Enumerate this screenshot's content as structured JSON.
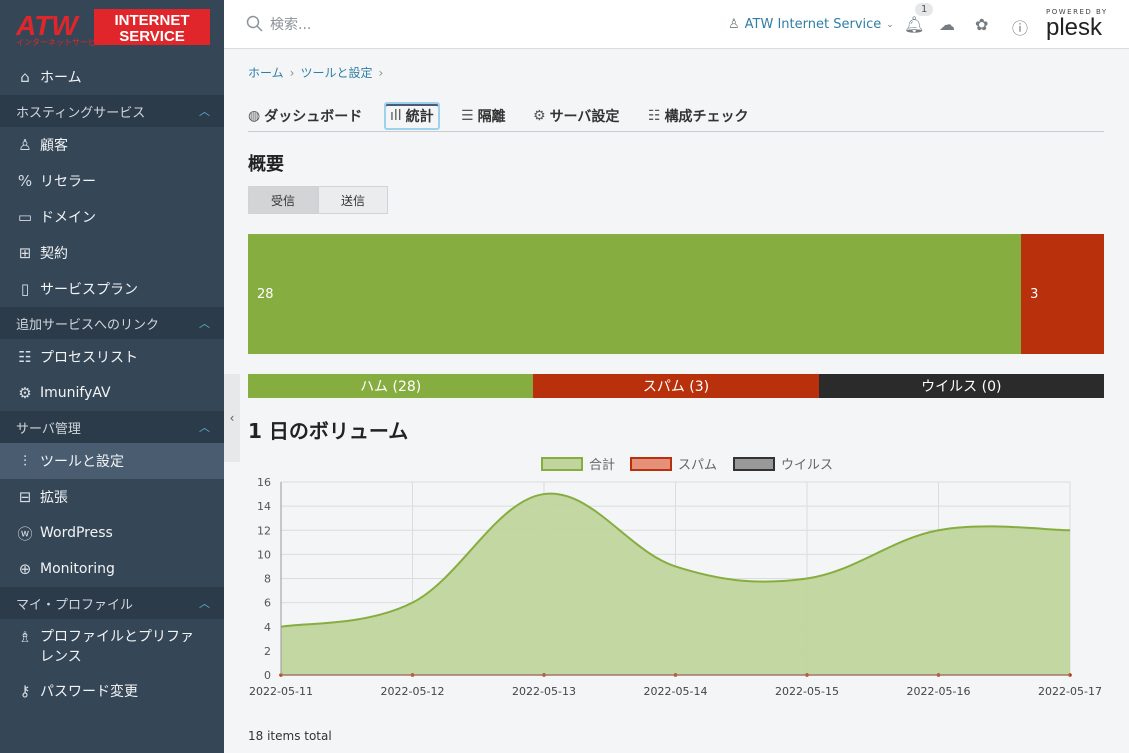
{
  "brand": {
    "line1": "ATW",
    "line2": "INTERNET",
    "line3": "SERVICE",
    "sub": "インターネットサービス"
  },
  "sidebar": {
    "home": "ホーム",
    "sec_hosting": "ホスティングサービス",
    "customers": "顧客",
    "resellers": "リセラー",
    "domains": "ドメイン",
    "subscriptions": "契約",
    "service_plans": "サービスプラン",
    "sec_links": "追加サービスへのリンク",
    "process_list": "プロセスリスト",
    "imunify": "ImunifyAV",
    "sec_server": "サーバ管理",
    "tools": "ツールと設定",
    "extensions": "拡張",
    "wordpress": "WordPress",
    "monitoring": "Monitoring",
    "sec_profile": "マイ・プロファイル",
    "profile_prefs": "プロファイルとプリファレンス",
    "password": "パスワード変更"
  },
  "topbar": {
    "search_placeholder": "検索...",
    "account": "ATW Internet Service",
    "notif_count": "1",
    "plesk_powered": "POWERED BY",
    "plesk_name": "plesk"
  },
  "breadcrumb": {
    "home": "ホーム",
    "tools": "ツールと設定"
  },
  "tabs": [
    "ダッシュボード",
    "統計",
    "隔離",
    "サーバ設定",
    "構成チェック"
  ],
  "overview": {
    "title": "概要",
    "incoming": "受信",
    "outgoing": "送信",
    "ham_count": "28",
    "spam_count": "3",
    "ham_label": "ハム (28)",
    "spam_label": "スパム (3)",
    "virus_label": "ウイルス (0)"
  },
  "volume_title": "1 日のボリューム",
  "footer_total": "18 items total",
  "colors": {
    "ham": "#86ad3f",
    "spam": "#b8300c",
    "virus": "#2b2b2b",
    "area": "#c0d59d",
    "line": "#86ad3f"
  },
  "chart_data": {
    "type": "area",
    "title": "",
    "x": [
      "2022-05-11",
      "2022-05-12",
      "2022-05-13",
      "2022-05-14",
      "2022-05-15",
      "2022-05-16",
      "2022-05-17"
    ],
    "series": [
      {
        "name": "合計",
        "values": [
          4,
          6,
          15,
          9,
          8,
          12,
          12
        ]
      },
      {
        "name": "スパム",
        "values": [
          0,
          0,
          0,
          0,
          0,
          0,
          0
        ]
      },
      {
        "name": "ウイルス",
        "values": [
          0,
          0,
          0,
          0,
          0,
          0,
          0
        ]
      }
    ],
    "ylim": [
      0,
      16
    ],
    "yticks": [
      0,
      2,
      4,
      6,
      8,
      10,
      12,
      14,
      16
    ],
    "grid": true,
    "legend": "top-center"
  }
}
